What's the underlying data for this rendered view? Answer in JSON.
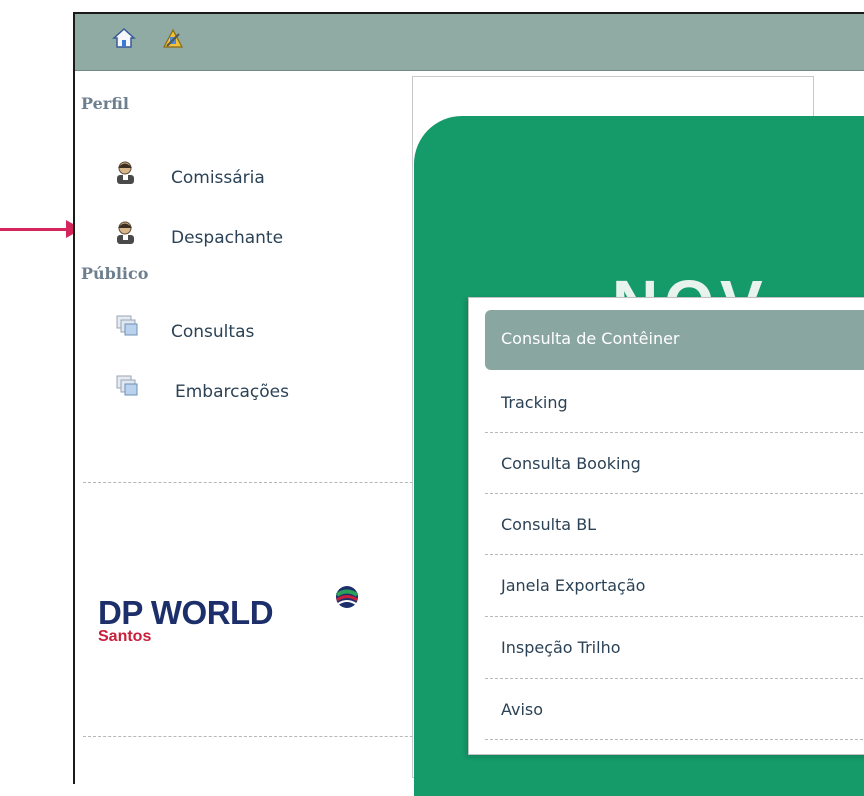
{
  "toolbar": {
    "home_icon": "home-icon",
    "tool_icon": "wrench-icon"
  },
  "sidebar": {
    "perfil_title": "Perfil",
    "publico_title": "Público",
    "perfil_items": [
      {
        "label": "Comissária",
        "icon": "user-icon"
      },
      {
        "label": "Despachante",
        "icon": "user-icon"
      }
    ],
    "publico_items": [
      {
        "label": "Consultas",
        "icon": "windows-icon"
      },
      {
        "label": "Embarcações",
        "icon": "windows-icon"
      }
    ]
  },
  "logo": {
    "name": "DP WORLD",
    "subtitle": "Santos"
  },
  "banner": {
    "text": "NOV"
  },
  "dropdown": {
    "items": [
      {
        "label": "Consulta de Contêiner",
        "active": true
      },
      {
        "label": "Tracking"
      },
      {
        "label": "Consulta Booking"
      },
      {
        "label": "Consulta BL"
      },
      {
        "label": "Janela Exportação"
      },
      {
        "label": "Inspeção Trilho"
      },
      {
        "label": "Aviso"
      }
    ]
  },
  "colors": {
    "topbar": "#8faba4",
    "banner": "#159a6a",
    "active_item": "#8aa6a0",
    "annotation_arrow": "#d6245c"
  }
}
